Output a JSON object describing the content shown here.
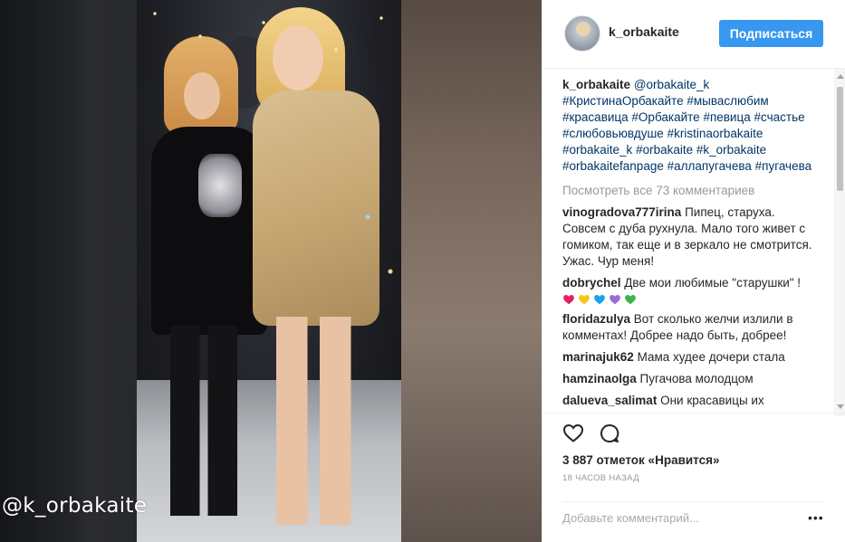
{
  "watermark": "@k_orbakaite",
  "header": {
    "username": "k_orbakaite",
    "follow_label": "Подписаться"
  },
  "caption": {
    "username": "k_orbakaite",
    "parts": [
      {
        "text": "@orbakaite_k",
        "tag": true
      },
      {
        "text": " ",
        "tag": false
      },
      {
        "text": "#КристинаОрбакайте",
        "tag": true
      },
      {
        "text": " ",
        "tag": false
      },
      {
        "text": "#мываслюбим",
        "tag": true
      },
      {
        "text": " ",
        "tag": false
      },
      {
        "text": "#красавица",
        "tag": true
      },
      {
        "text": " ",
        "tag": false
      },
      {
        "text": "#Орбакайте",
        "tag": true
      },
      {
        "text": " ",
        "tag": false
      },
      {
        "text": "#певица",
        "tag": true
      },
      {
        "text": " ",
        "tag": false
      },
      {
        "text": "#счастье",
        "tag": true
      },
      {
        "text": " ",
        "tag": false
      },
      {
        "text": "#слюбовьювдуше",
        "tag": true
      },
      {
        "text": " ",
        "tag": false
      },
      {
        "text": "#kristinaorbakaite",
        "tag": true
      },
      {
        "text": " ",
        "tag": false
      },
      {
        "text": "#orbakaite_k",
        "tag": true
      },
      {
        "text": " ",
        "tag": false
      },
      {
        "text": "#orbakaite",
        "tag": true
      },
      {
        "text": " ",
        "tag": false
      },
      {
        "text": "#k_orbakaite",
        "tag": true
      },
      {
        "text": " ",
        "tag": false
      },
      {
        "text": "#orbakaitefanpage",
        "tag": true
      },
      {
        "text": " ",
        "tag": false
      },
      {
        "text": "#аллапугачева",
        "tag": true
      },
      {
        "text": " ",
        "tag": false
      },
      {
        "text": "#пугачева",
        "tag": true
      }
    ]
  },
  "view_all": "Посмотреть все 73 комментариев",
  "comments": [
    {
      "user": "vinogradova777irina",
      "text": "Пипец, старуха. Совсем с дуба рухнула. Мало того живет с гомиком, так еще и в зеркало не смотрится. Ужас. Чур меня!"
    },
    {
      "user": "dobrychel",
      "text": "Две мои любимые \"старушки\" !"
    },
    {
      "user": "floridazulya",
      "text": "Вот сколько желчи излили в комментах! Добрее надо быть, добрее!"
    },
    {
      "user": "marinajuk62",
      "text": "Мама худее дочери стала"
    },
    {
      "user": "hamzinaolga",
      "text": "Пугачова молодцом"
    },
    {
      "user": "dalueva_salimat",
      "text": "Они красавицы их"
    }
  ],
  "hearts": [
    {
      "icon": "red-heart-icon",
      "color": "#e0245e"
    },
    {
      "icon": "yellow-heart-icon",
      "color": "#f5c518"
    },
    {
      "icon": "blue-heart-icon",
      "color": "#1da1f2"
    },
    {
      "icon": "purple-heart-icon",
      "color": "#9b6bd6"
    },
    {
      "icon": "green-heart-icon",
      "color": "#3bb54a"
    }
  ],
  "likes": "3 887 отметок «Нравится»",
  "time": "18 ЧАСОВ НАЗАД",
  "add_comment_placeholder": "Добавьте комментарий...",
  "more_label": "•••",
  "colors": {
    "accent": "#3897f0",
    "hashtag": "#003569",
    "muted": "#999999"
  }
}
